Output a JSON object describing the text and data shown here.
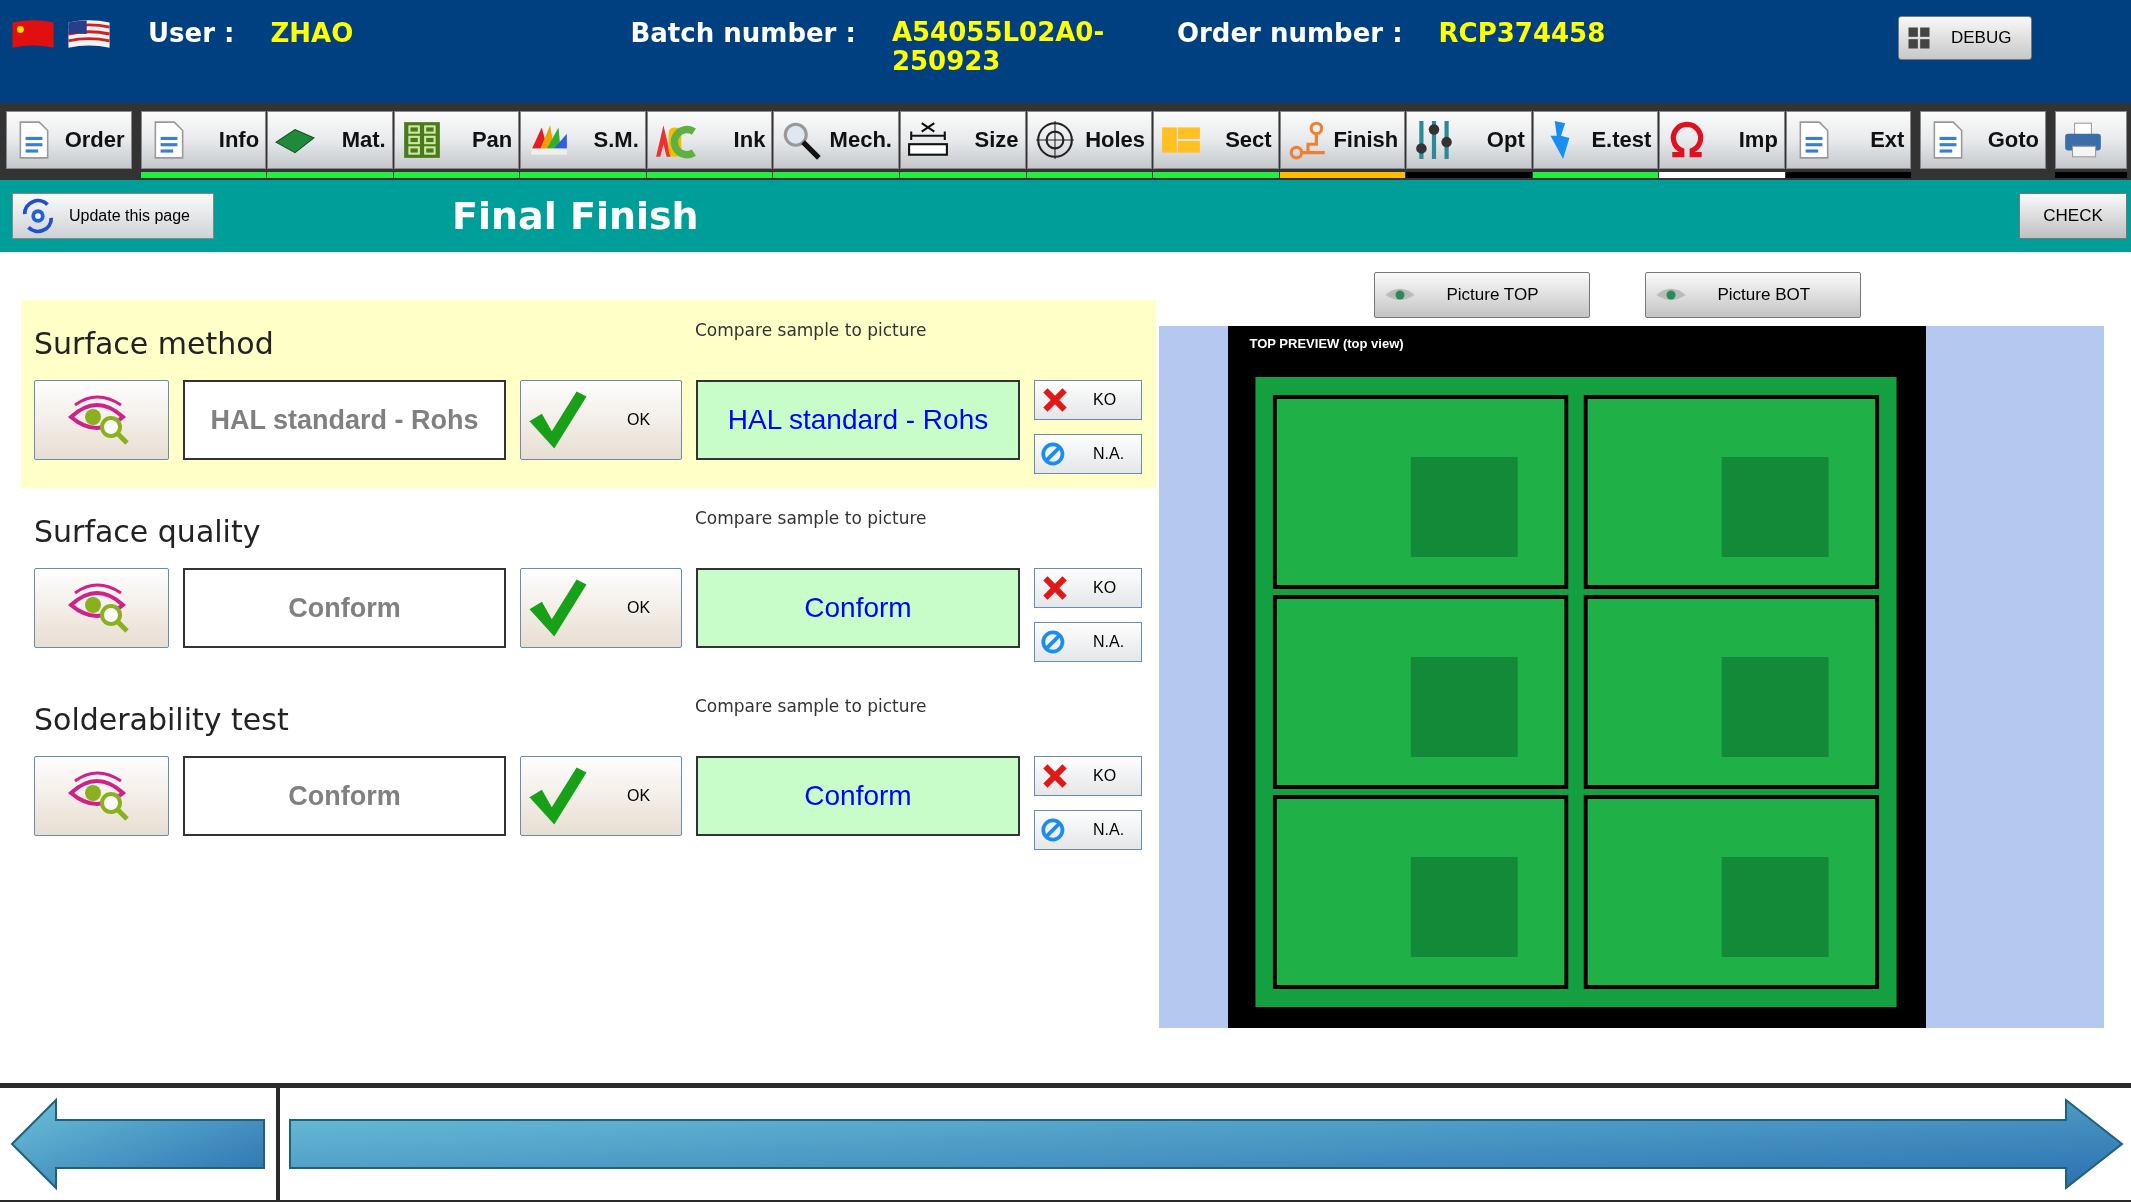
{
  "header": {
    "flags": [
      {
        "kind": "cn"
      },
      {
        "kind": "us"
      }
    ],
    "user_label": "User :",
    "user": "ZHAO",
    "batch_label": "Batch number :",
    "batch": "A54055L02A0-250923",
    "order_label": "Order number :",
    "order": "RCP374458",
    "debug_button": "DEBUG"
  },
  "toolbar": [
    {
      "label": "Order",
      "kind": "doc"
    },
    {
      "label": "Info",
      "kind": "doc",
      "color": "#22ee44"
    },
    {
      "label": "Mat.",
      "kind": "board",
      "color": "#22ee44"
    },
    {
      "label": "Pan",
      "kind": "grid",
      "color": "#22ee44"
    },
    {
      "label": "S.M.",
      "kind": "fan",
      "color": "#22ee44"
    },
    {
      "label": "Ink",
      "kind": "abc",
      "color": "#22ee44"
    },
    {
      "label": "Mech.",
      "kind": "magnifier",
      "color": "#22ee44"
    },
    {
      "label": "Size",
      "kind": "ruler",
      "color": "#22ee44"
    },
    {
      "label": "Holes",
      "kind": "target",
      "color": "#22ee44"
    },
    {
      "label": "Sect",
      "kind": "blocks",
      "color": "#22ee44"
    },
    {
      "label": "Finish",
      "kind": "circuit",
      "color": "#ffbb00"
    },
    {
      "label": "Opt",
      "kind": "sliders",
      "color": "#000000"
    },
    {
      "label": "E.test",
      "kind": "bolt",
      "color": "#22ee44"
    },
    {
      "label": "Imp",
      "kind": "omega",
      "color": "#ffffff"
    },
    {
      "label": "Ext",
      "kind": "doc",
      "color": "#000000"
    },
    {
      "label": "Goto",
      "kind": "doc"
    },
    {
      "kind": "printer",
      "color": "#000000"
    }
  ],
  "page_bar": {
    "update_button": "Update this page",
    "title": "Final Finish",
    "check_button": "CHECK"
  },
  "checks": [
    {
      "title": "Surface method",
      "hint": "Compare sample to picture",
      "value": "HAL standard - Rohs",
      "ok_button": "OK",
      "result": "HAL standard - Rohs",
      "ko_button": "KO",
      "na_button": "N.A.",
      "selected": true
    },
    {
      "title": "Surface quality",
      "hint": "Compare sample to picture",
      "value": "Conform",
      "ok_button": "OK",
      "result": "Conform",
      "ko_button": "KO",
      "na_button": "N.A.",
      "selected": false
    },
    {
      "title": "Solderability test",
      "hint": "Compare sample to picture",
      "value": "Conform",
      "ok_button": "OK",
      "result": "Conform",
      "ko_button": "KO",
      "na_button": "N.A.",
      "selected": false
    }
  ],
  "preview": {
    "buttons": [
      "Picture TOP",
      "Picture BOT"
    ],
    "title": "TOP PREVIEW (top view)",
    "image": {
      "kind": "picture"
    }
  }
}
